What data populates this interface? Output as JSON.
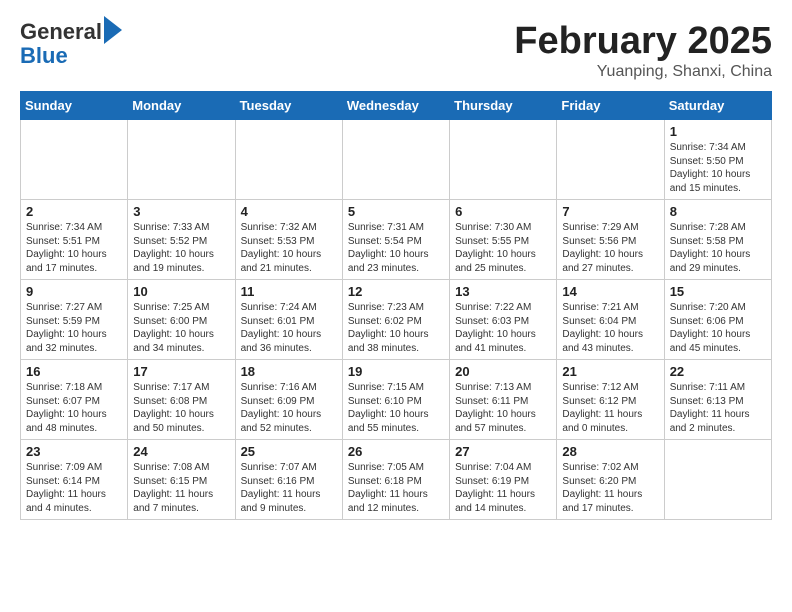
{
  "header": {
    "logo_line1": "General",
    "logo_line2": "Blue",
    "month_title": "February 2025",
    "location": "Yuanping, Shanxi, China"
  },
  "weekdays": [
    "Sunday",
    "Monday",
    "Tuesday",
    "Wednesday",
    "Thursday",
    "Friday",
    "Saturday"
  ],
  "weeks": [
    [
      {
        "day": "",
        "info": ""
      },
      {
        "day": "",
        "info": ""
      },
      {
        "day": "",
        "info": ""
      },
      {
        "day": "",
        "info": ""
      },
      {
        "day": "",
        "info": ""
      },
      {
        "day": "",
        "info": ""
      },
      {
        "day": "1",
        "info": "Sunrise: 7:34 AM\nSunset: 5:50 PM\nDaylight: 10 hours and 15 minutes."
      }
    ],
    [
      {
        "day": "2",
        "info": "Sunrise: 7:34 AM\nSunset: 5:51 PM\nDaylight: 10 hours and 17 minutes."
      },
      {
        "day": "3",
        "info": "Sunrise: 7:33 AM\nSunset: 5:52 PM\nDaylight: 10 hours and 19 minutes."
      },
      {
        "day": "4",
        "info": "Sunrise: 7:32 AM\nSunset: 5:53 PM\nDaylight: 10 hours and 21 minutes."
      },
      {
        "day": "5",
        "info": "Sunrise: 7:31 AM\nSunset: 5:54 PM\nDaylight: 10 hours and 23 minutes."
      },
      {
        "day": "6",
        "info": "Sunrise: 7:30 AM\nSunset: 5:55 PM\nDaylight: 10 hours and 25 minutes."
      },
      {
        "day": "7",
        "info": "Sunrise: 7:29 AM\nSunset: 5:56 PM\nDaylight: 10 hours and 27 minutes."
      },
      {
        "day": "8",
        "info": "Sunrise: 7:28 AM\nSunset: 5:58 PM\nDaylight: 10 hours and 29 minutes."
      }
    ],
    [
      {
        "day": "9",
        "info": "Sunrise: 7:27 AM\nSunset: 5:59 PM\nDaylight: 10 hours and 32 minutes."
      },
      {
        "day": "10",
        "info": "Sunrise: 7:25 AM\nSunset: 6:00 PM\nDaylight: 10 hours and 34 minutes."
      },
      {
        "day": "11",
        "info": "Sunrise: 7:24 AM\nSunset: 6:01 PM\nDaylight: 10 hours and 36 minutes."
      },
      {
        "day": "12",
        "info": "Sunrise: 7:23 AM\nSunset: 6:02 PM\nDaylight: 10 hours and 38 minutes."
      },
      {
        "day": "13",
        "info": "Sunrise: 7:22 AM\nSunset: 6:03 PM\nDaylight: 10 hours and 41 minutes."
      },
      {
        "day": "14",
        "info": "Sunrise: 7:21 AM\nSunset: 6:04 PM\nDaylight: 10 hours and 43 minutes."
      },
      {
        "day": "15",
        "info": "Sunrise: 7:20 AM\nSunset: 6:06 PM\nDaylight: 10 hours and 45 minutes."
      }
    ],
    [
      {
        "day": "16",
        "info": "Sunrise: 7:18 AM\nSunset: 6:07 PM\nDaylight: 10 hours and 48 minutes."
      },
      {
        "day": "17",
        "info": "Sunrise: 7:17 AM\nSunset: 6:08 PM\nDaylight: 10 hours and 50 minutes."
      },
      {
        "day": "18",
        "info": "Sunrise: 7:16 AM\nSunset: 6:09 PM\nDaylight: 10 hours and 52 minutes."
      },
      {
        "day": "19",
        "info": "Sunrise: 7:15 AM\nSunset: 6:10 PM\nDaylight: 10 hours and 55 minutes."
      },
      {
        "day": "20",
        "info": "Sunrise: 7:13 AM\nSunset: 6:11 PM\nDaylight: 10 hours and 57 minutes."
      },
      {
        "day": "21",
        "info": "Sunrise: 7:12 AM\nSunset: 6:12 PM\nDaylight: 11 hours and 0 minutes."
      },
      {
        "day": "22",
        "info": "Sunrise: 7:11 AM\nSunset: 6:13 PM\nDaylight: 11 hours and 2 minutes."
      }
    ],
    [
      {
        "day": "23",
        "info": "Sunrise: 7:09 AM\nSunset: 6:14 PM\nDaylight: 11 hours and 4 minutes."
      },
      {
        "day": "24",
        "info": "Sunrise: 7:08 AM\nSunset: 6:15 PM\nDaylight: 11 hours and 7 minutes."
      },
      {
        "day": "25",
        "info": "Sunrise: 7:07 AM\nSunset: 6:16 PM\nDaylight: 11 hours and 9 minutes."
      },
      {
        "day": "26",
        "info": "Sunrise: 7:05 AM\nSunset: 6:18 PM\nDaylight: 11 hours and 12 minutes."
      },
      {
        "day": "27",
        "info": "Sunrise: 7:04 AM\nSunset: 6:19 PM\nDaylight: 11 hours and 14 minutes."
      },
      {
        "day": "28",
        "info": "Sunrise: 7:02 AM\nSunset: 6:20 PM\nDaylight: 11 hours and 17 minutes."
      },
      {
        "day": "",
        "info": ""
      }
    ]
  ]
}
